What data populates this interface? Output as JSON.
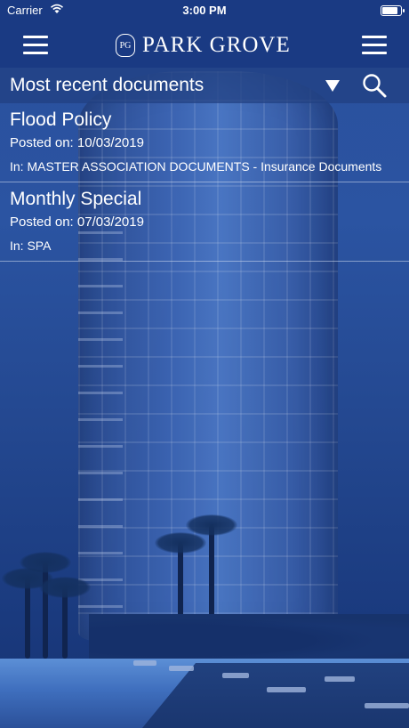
{
  "status_bar": {
    "carrier": "Carrier",
    "time": "3:00 PM",
    "battery_level": 0.95
  },
  "header": {
    "brand_name": "PARK GROVE",
    "brand_logo_icon": "pg-crest-icon",
    "left_icon": "hamburger-menu-icon",
    "right_icon": "hamburger-menu-icon"
  },
  "filter": {
    "label": "Most recent documents",
    "dropdown_icon": "triangle-down-icon",
    "search_icon": "search-icon"
  },
  "documents": [
    {
      "title": "Flood Policy",
      "posted": "Posted on: 10/03/2019",
      "folder": "In: MASTER ASSOCIATION DOCUMENTS - Insurance Documents"
    },
    {
      "title": "Monthly Special",
      "posted": "Posted on: 07/03/2019",
      "folder": "In: SPA"
    }
  ],
  "colors": {
    "header_bg": "#1a3a83",
    "text": "#ffffff",
    "divider": "#d2dcf0"
  }
}
